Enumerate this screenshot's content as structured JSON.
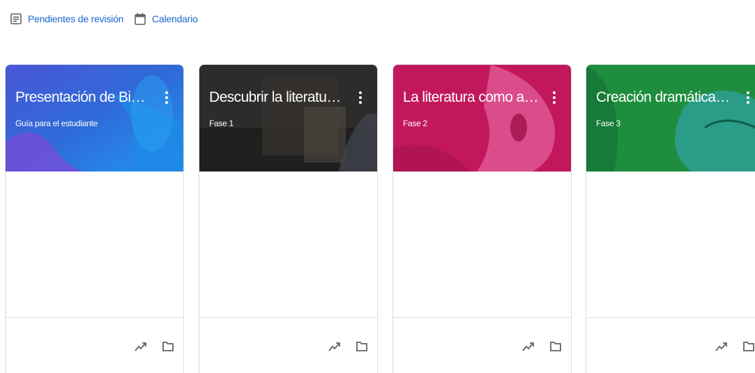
{
  "nav": {
    "pending_label": "Pendientes de revisión",
    "calendar_label": "Calendario"
  },
  "colors": {
    "link": "#1967d2",
    "card1": "#3d5bd8",
    "card2": "#3b3b3b",
    "card3": "#c2185b",
    "card4": "#1e8e3e"
  },
  "cards": [
    {
      "title": "Presentación de Bien...",
      "subtitle": "Guía para el estudiante",
      "icons": [
        "more-vert-icon",
        "trending-icon",
        "folder-icon"
      ]
    },
    {
      "title": "Descubrir la literatura...",
      "subtitle": "Fase 1",
      "icons": [
        "more-vert-icon",
        "trending-icon",
        "folder-icon"
      ]
    },
    {
      "title": "La literatura como art...",
      "subtitle": "Fase 2",
      "icons": [
        "more-vert-icon",
        "trending-icon",
        "folder-icon"
      ]
    },
    {
      "title": "Creación dramática, l...",
      "subtitle": "Fase 3",
      "icons": [
        "more-vert-icon",
        "trending-icon",
        "folder-icon"
      ]
    }
  ]
}
